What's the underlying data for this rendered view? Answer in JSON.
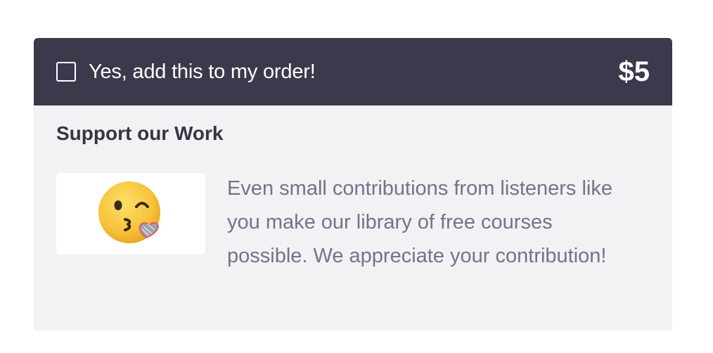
{
  "order_toggle": {
    "label": "Yes, add this to my order!",
    "checked": false
  },
  "price": "$5",
  "support": {
    "title": "Support our Work",
    "image_icon": "kissing-face-with-heart-emoji",
    "description": "Even small contributions from listeners like you make our library of free courses possible. We appreciate your contribution!"
  },
  "colors": {
    "header_bg": "#3a3a4c",
    "body_bg": "#f1f2f4",
    "title_text": "#353545",
    "description_text": "#73738a",
    "emoji_yellow": "#f7c23a"
  }
}
